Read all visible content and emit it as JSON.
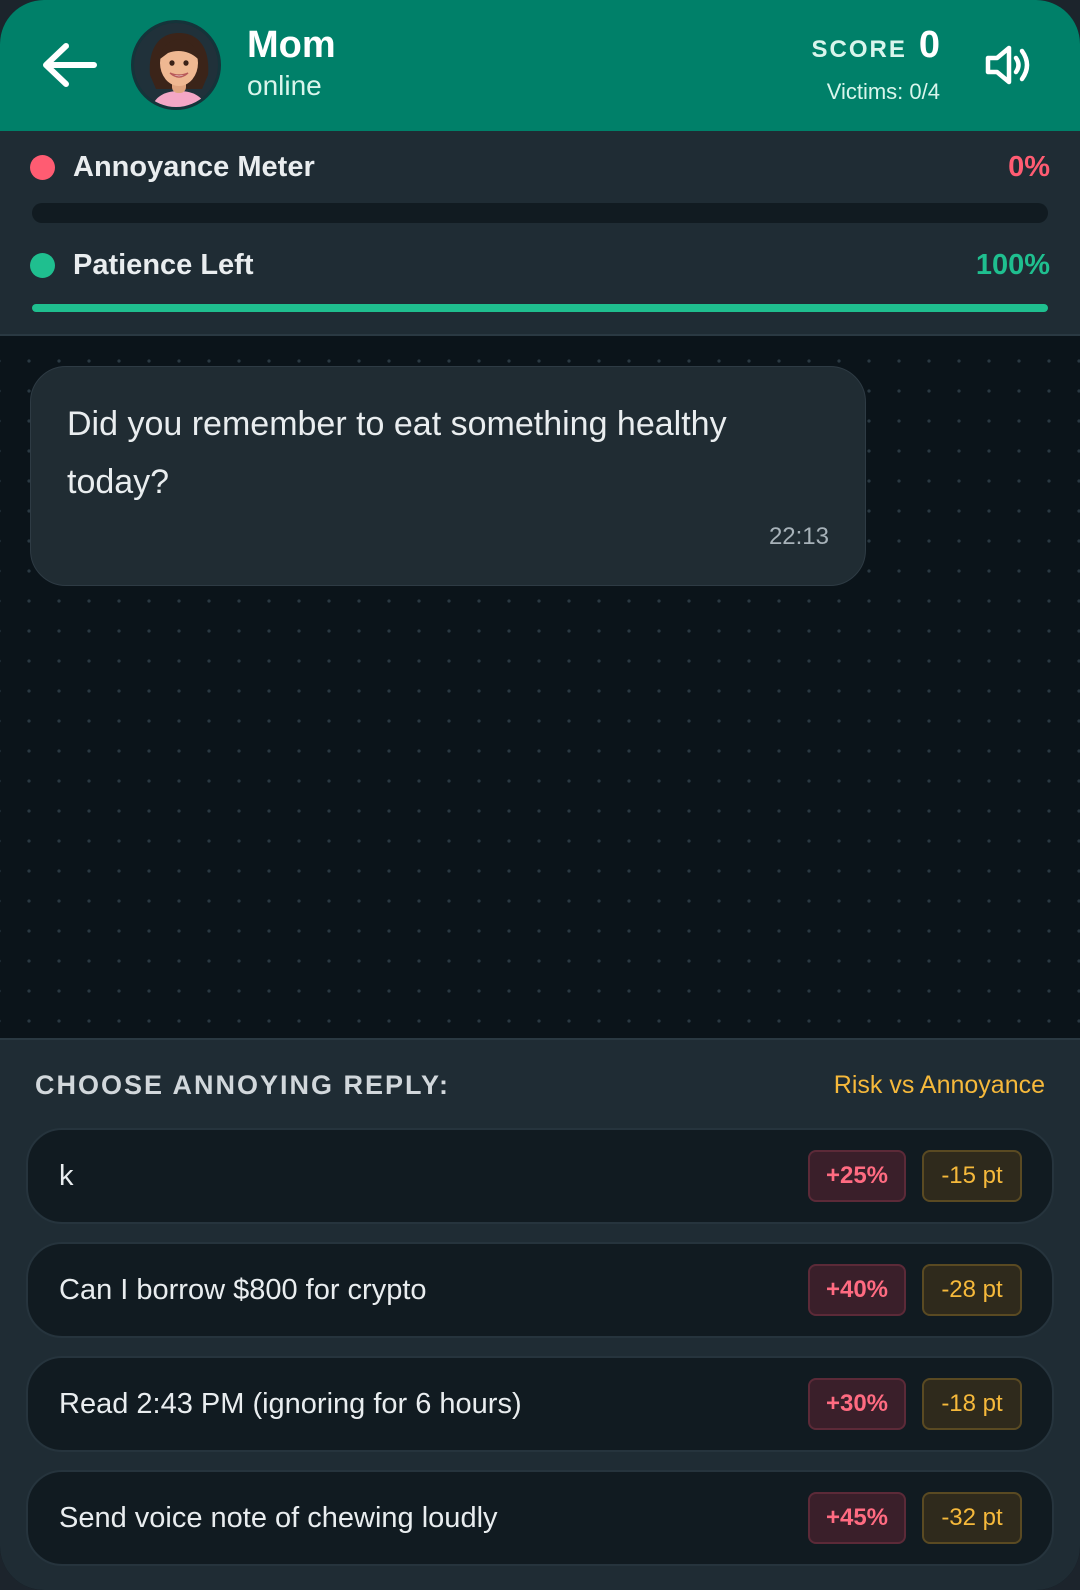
{
  "header": {
    "contact_name": "Mom",
    "contact_status": "online",
    "score_label": "SCORE",
    "score_value": "0",
    "victims": "Victims: 0/4",
    "icons": {
      "back": "arrow-left-icon",
      "sound": "speaker-icon"
    }
  },
  "meters": {
    "annoyance": {
      "label": "Annoyance Meter",
      "value": "0%",
      "level": 0,
      "color": "#ff5c72"
    },
    "patience": {
      "label": "Patience Left",
      "value": "100%",
      "level": 1.0,
      "color": "#1fbf8f"
    }
  },
  "chat": {
    "messages": [
      {
        "text": "Did you remember to eat something healthy today?",
        "time": "22:13"
      }
    ]
  },
  "replies": {
    "title": "CHOOSE ANNOYING REPLY:",
    "hint": "Risk vs Annoyance",
    "options": [
      {
        "text": "k",
        "risk": "+25%",
        "points": "-15 pt"
      },
      {
        "text": "Can I borrow $800 for crypto",
        "risk": "+40%",
        "points": "-28 pt"
      },
      {
        "text": "Read 2:43 PM (ignoring for 6 hours)",
        "risk": "+30%",
        "points": "-18 pt"
      },
      {
        "text": "Send voice note of chewing loudly",
        "risk": "+45%",
        "points": "-32 pt"
      }
    ]
  },
  "colors": {
    "header_bg": "#008069",
    "accent_red": "#ff5c72",
    "accent_green": "#1fbf8f",
    "accent_yellow": "#f6b93b"
  }
}
